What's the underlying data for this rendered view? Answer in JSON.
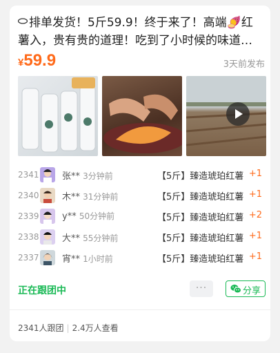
{
  "post": {
    "title": "排单发货！5斤59.9！终于来了！高端🍠红薯入，贵有贵的道理！吃到了小时候的味道！你还记得小时候红薯的味道吗",
    "currency": "¥",
    "price": "59.9",
    "posted": "3天前发布"
  },
  "media": [
    {
      "icon": "sweet-potato-packages-photo"
    },
    {
      "icon": "peeled-sweet-potato-photo"
    },
    {
      "icon": "farm-field-video-thumbnail"
    }
  ],
  "orders": [
    {
      "seq": "2341",
      "user": "张**",
      "time": "3分钟前",
      "product": "【5斤】臻造琥珀红薯",
      "qty": "+1"
    },
    {
      "seq": "2340",
      "user": "木**",
      "time": "31分钟前",
      "product": "【5斤】臻造琥珀红薯",
      "qty": "+1"
    },
    {
      "seq": "2339",
      "user": "y**",
      "time": "50分钟前",
      "product": "【5斤】臻造琥珀红薯",
      "qty": "+2"
    },
    {
      "seq": "2338",
      "user": "大**",
      "time": "55分钟前",
      "product": "【5斤】臻造琥珀红薯",
      "qty": "+1"
    },
    {
      "seq": "2337",
      "user": "宵**",
      "time": "1小时前",
      "product": "【5斤】臻造琥珀红薯",
      "qty": "+1"
    }
  ],
  "actions": {
    "status": "正在跟团中",
    "more": "···",
    "share": "分享"
  },
  "stats": {
    "followers": "2341人跟团",
    "views": "2.4万人查看",
    "separator": "|"
  },
  "colors": {
    "accent": "#ff6a1a",
    "green": "#19b955"
  }
}
